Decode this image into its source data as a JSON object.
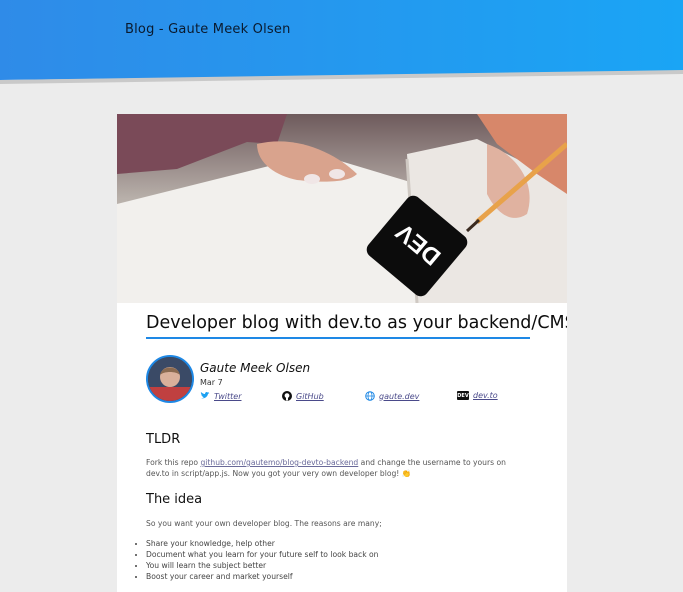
{
  "site": {
    "title": "Blog - Gaute Meek Olsen"
  },
  "hero": {
    "badge_text": "DEV"
  },
  "post": {
    "title": "Developer blog with dev.to as your backend/CMS",
    "author": "Gaute Meek Olsen",
    "date": "Mar 7",
    "links": [
      {
        "label": "Twitter",
        "icon": "twitter-icon"
      },
      {
        "label": "GitHub",
        "icon": "github-icon"
      },
      {
        "label": "gaute.dev",
        "icon": "globe-icon"
      },
      {
        "label": "dev.to",
        "icon": "dev-icon"
      }
    ],
    "dev_icon_text": "DEV",
    "tldr": {
      "heading": "TLDR",
      "text_before": "Fork this repo ",
      "link": "github.com/gautemo/blog-devto-backend",
      "text_after": " and change the username to yours on dev.to in script/app.js. Now you got your very own developer blog! 👏"
    },
    "idea": {
      "heading": "The idea",
      "intro": "So you want your own developer blog. The reasons are many;",
      "bullets": [
        "Share your knowledge, help other",
        "Document what you learn for your future self to look back on",
        "You will learn the subject better",
        "Boost your career and market yourself"
      ]
    }
  },
  "colors": {
    "accent": "#1e88e5",
    "header_start": "#2f8be8",
    "header_end": "#1aa5f5"
  }
}
